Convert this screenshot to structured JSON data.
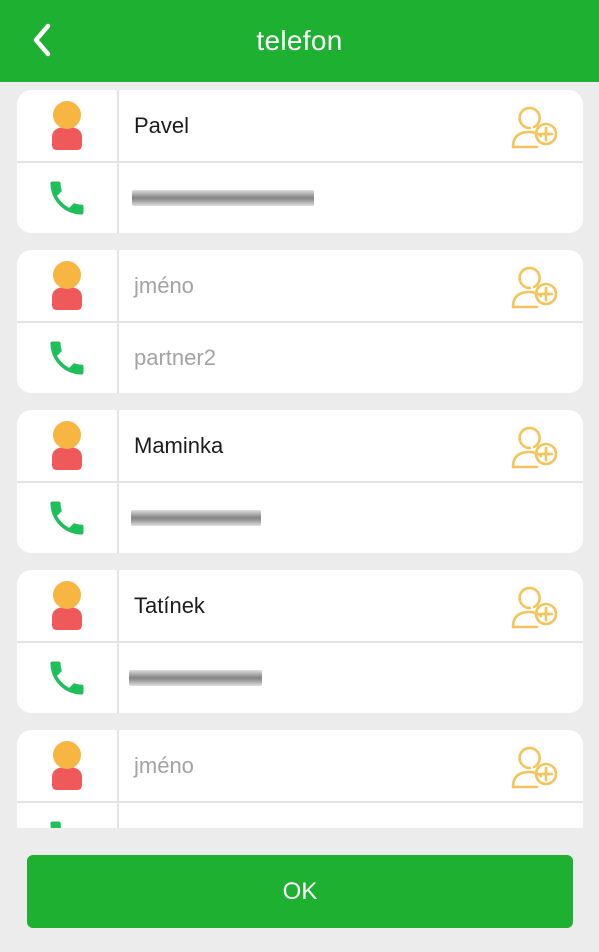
{
  "header": {
    "title": "telefon",
    "back_icon": "chevron-left-icon"
  },
  "colors": {
    "header_bg": "#1eb030",
    "button_bg": "#1eb030",
    "avatar_head": "#f7b541",
    "avatar_body": "#f0595a",
    "phone_icon": "#1fbf5a",
    "add_icon": "#f5c35a",
    "page_bg": "#ececec",
    "placeholder_text": "#a3a3a3"
  },
  "contacts": [
    {
      "name": "Pavel",
      "name_placeholder": "",
      "phone": "",
      "phone_placeholder": "",
      "phone_redacted": true
    },
    {
      "name": "",
      "name_placeholder": "jméno",
      "phone": "",
      "phone_placeholder": "partner2",
      "phone_redacted": false
    },
    {
      "name": "Maminka",
      "name_placeholder": "",
      "phone": "",
      "phone_placeholder": "",
      "phone_redacted": true
    },
    {
      "name": "Tatínek",
      "name_placeholder": "",
      "phone": "",
      "phone_placeholder": "",
      "phone_redacted": true
    },
    {
      "name": "",
      "name_placeholder": "jméno",
      "phone": "",
      "phone_placeholder": "",
      "phone_redacted": false
    }
  ],
  "footer": {
    "ok_label": "OK"
  }
}
